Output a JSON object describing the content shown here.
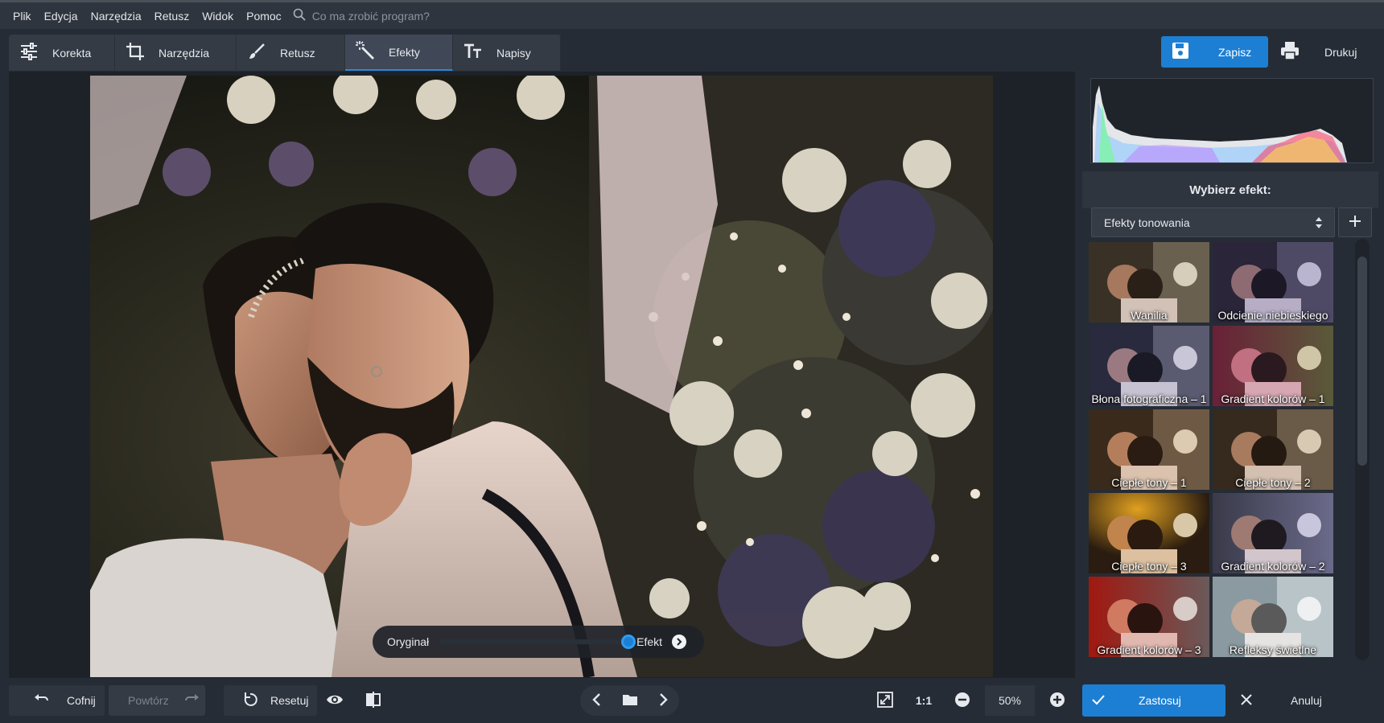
{
  "menu": {
    "items": [
      "Plik",
      "Edycja",
      "Narzędzia",
      "Retusz",
      "Widok",
      "Pomoc"
    ],
    "search_placeholder": "Co ma zrobić program?"
  },
  "tabs": [
    {
      "label": "Korekta",
      "icon": "sliders-icon"
    },
    {
      "label": "Narzędzia",
      "icon": "crop-icon"
    },
    {
      "label": "Retusz",
      "icon": "brush-icon"
    },
    {
      "label": "Efekty",
      "icon": "magic-wand-icon",
      "active": true
    },
    {
      "label": "Napisy",
      "icon": "text-icon"
    }
  ],
  "toolbar": {
    "save_label": "Zapisz",
    "print_label": "Drukuj"
  },
  "compare": {
    "original_label": "Oryginał",
    "effect_label": "Efekt",
    "level": 1.0
  },
  "effects_panel": {
    "title": "Wybierz efekt:",
    "category": "Efekty tonowania",
    "items": [
      {
        "label": "Wanilia"
      },
      {
        "label": "Odcienie niebieskiego"
      },
      {
        "label": "Błona fotograficzna – 1"
      },
      {
        "label": "Gradient kolorów – 1"
      },
      {
        "label": "Ciepłe tony – 1"
      },
      {
        "label": "Ciepłe tony – 2"
      },
      {
        "label": "Ciepłe tony – 3"
      },
      {
        "label": "Gradient kolorów – 2"
      },
      {
        "label": "Gradient kolorów – 3"
      },
      {
        "label": "Refleksy świetlne"
      }
    ]
  },
  "bottom": {
    "undo_label": "Cofnij",
    "redo_label": "Powtórz",
    "reset_label": "Resetuj",
    "zoom_11": "1:1",
    "zoom_value": "50%",
    "apply_label": "Zastosuj",
    "cancel_label": "Anuluj"
  },
  "colors": {
    "accent": "#1d7fd3",
    "background": "#262c35"
  }
}
